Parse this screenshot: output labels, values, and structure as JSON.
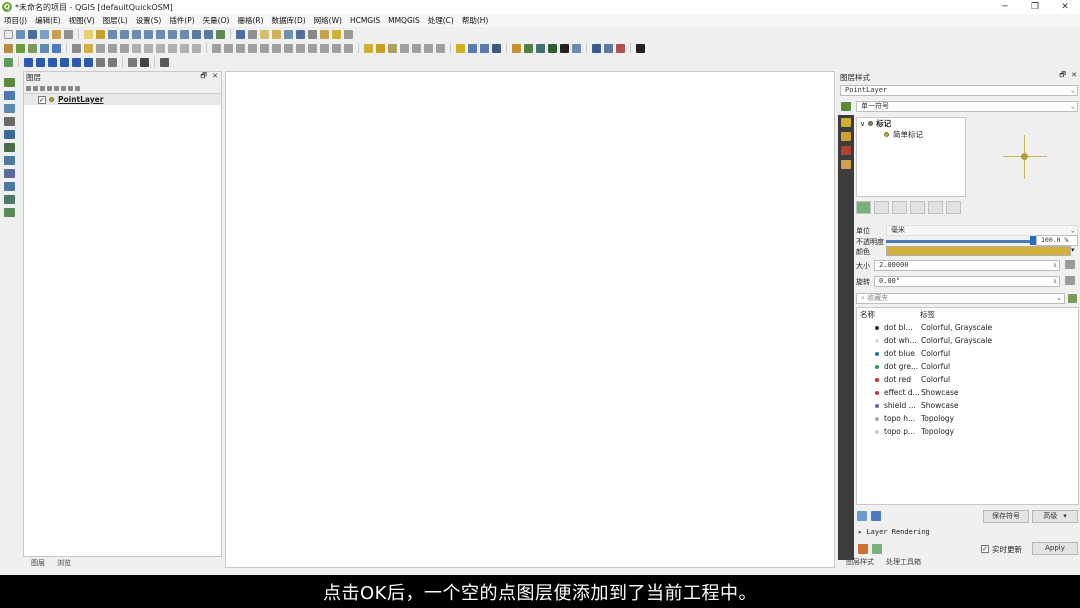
{
  "window": {
    "title": "*未命名的项目 - QGIS [defaultQuickOSM]",
    "app_icon": "Q",
    "minimize": "─",
    "maximize": "❐",
    "close": "✕"
  },
  "menubar": [
    "项目(J)",
    "编辑(E)",
    "视图(V)",
    "图层(L)",
    "设置(S)",
    "插件(P)",
    "矢量(O)",
    "栅格(R)",
    "数据库(D)",
    "网络(W)",
    "HCMGIS",
    "MMQGIS",
    "处理(C)",
    "帮助(H)"
  ],
  "layers_panel": {
    "title": "图层",
    "float_icon": "🗗",
    "close_icon": "✕",
    "layers": [
      {
        "name": "PointLayer",
        "checked": "✓"
      }
    ],
    "bottom_tabs": [
      "图层",
      "浏览"
    ]
  },
  "style_panel": {
    "title": "图层样式",
    "float_icon": "🗗",
    "close_icon": "✕",
    "layer_combo": "PointLayer",
    "renderer_combo": "单一符号",
    "tree": {
      "root": "标记",
      "child": "简单标记"
    },
    "unit_label": "单位",
    "unit_value": "毫米",
    "opacity_label": "不透明度",
    "opacity_value": "100.0 %",
    "opacity_fraction": 1.0,
    "color_label": "颜色",
    "color_value": "#d4b13b",
    "size_label": "大小",
    "size_value": "2.00000",
    "rotation_label": "旋转",
    "rotation_value": "0.00°",
    "favorites_placeholder": "收藏夹",
    "columns": {
      "name": "名称",
      "tags": "标签"
    },
    "symbols": [
      {
        "name": "dot bl...",
        "tags": "Colorful, Grayscale",
        "color": "#333333"
      },
      {
        "name": "dot wh...",
        "tags": "Colorful, Grayscale",
        "color": "#dddddd"
      },
      {
        "name": "dot blue",
        "tags": "Colorful",
        "color": "#2a6fb5"
      },
      {
        "name": "dot gre...",
        "tags": "Colorful",
        "color": "#3a9a3a"
      },
      {
        "name": "dot red",
        "tags": "Colorful",
        "color": "#cc2a2a"
      },
      {
        "name": "effect d...",
        "tags": "Showcase",
        "color": "#c0392b"
      },
      {
        "name": "shield ...",
        "tags": "Showcase",
        "color": "#7a5ac0"
      },
      {
        "name": "topo h...",
        "tags": "Topology",
        "color": "#aaaaaa"
      },
      {
        "name": "topo p...",
        "tags": "Topology",
        "color": "#cccccc"
      }
    ],
    "save_symbol": "保存符号",
    "advanced": "高级",
    "layer_rendering": "Layer Rendering",
    "live_update": "实时更新",
    "live_update_checked": "✓",
    "apply": "Apply",
    "bottom_tabs": [
      "图层样式",
      "处理工具箱"
    ]
  },
  "subtitle": "点击OK后，一个空的点图层便添加到了当前工程中。"
}
